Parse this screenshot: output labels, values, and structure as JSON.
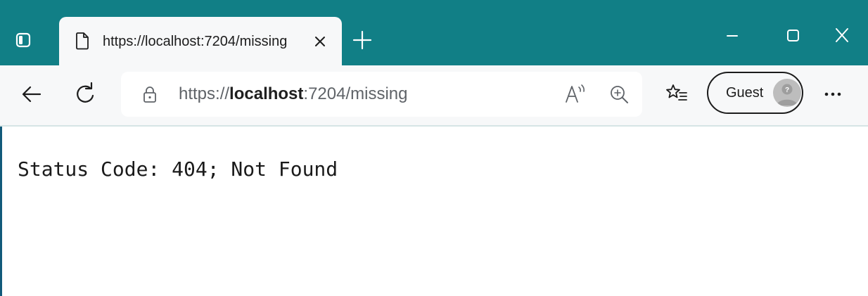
{
  "tab": {
    "title": "https://localhost:7204/missing"
  },
  "address_bar": {
    "url_prefix": "https://",
    "url_host": "localhost",
    "url_rest": ":7204/missing"
  },
  "profile": {
    "label": "Guest"
  },
  "page": {
    "status_text": "Status Code: 404; Not Found"
  },
  "icons": {
    "tab_actions": "tab-actions-icon",
    "page": "page-icon",
    "tab_close": "close-icon",
    "new_tab": "plus-icon",
    "minimize": "minimize-icon",
    "maximize": "maximize-icon",
    "close": "close-icon",
    "back": "back-arrow-icon",
    "refresh": "refresh-icon",
    "lock": "lock-icon",
    "read_aloud": "read-aloud-icon",
    "zoom": "zoom-in-icon",
    "favorites": "favorites-icon",
    "avatar": "guest-avatar-icon",
    "more": "more-icon"
  },
  "colors": {
    "titlebar": "#117f86",
    "toolbar": "#f7f8f9",
    "page_background": "#ffffff"
  }
}
